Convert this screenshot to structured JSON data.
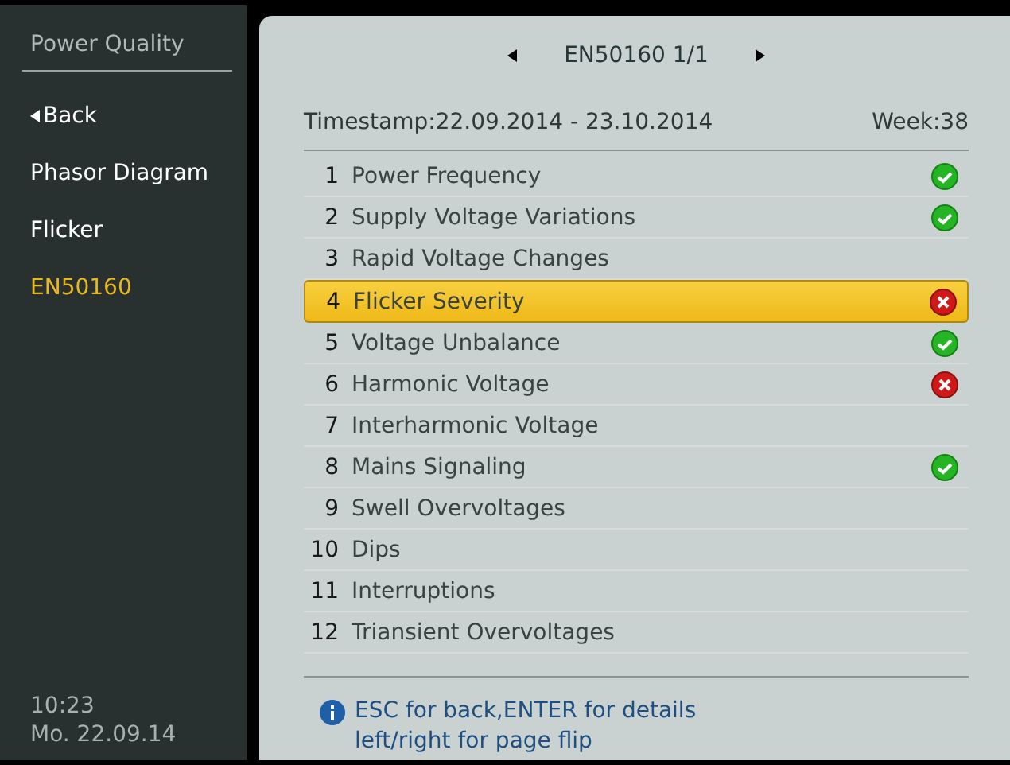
{
  "sidebar": {
    "title": "Power Quality",
    "items": [
      {
        "label": "Back",
        "kind": "back",
        "selected": false
      },
      {
        "label": "Phasor Diagram",
        "kind": "page",
        "selected": false
      },
      {
        "label": "Flicker",
        "kind": "page",
        "selected": false
      },
      {
        "label": "EN50160",
        "kind": "page",
        "selected": true
      }
    ],
    "time": "10:23",
    "date": "Mo. 22.09.14"
  },
  "header": {
    "title": "EN50160 1/1",
    "timestamp": "Timestamp:22.09.2014 - 23.10.2014",
    "week": "Week:38"
  },
  "rows": [
    {
      "number": "1",
      "label": "Power Frequency",
      "kind": "pass",
      "selected": false
    },
    {
      "number": "2",
      "label": "Supply Voltage Variations",
      "kind": "pass",
      "selected": false
    },
    {
      "number": "3",
      "label": "Rapid Voltage Changes",
      "kind": "none",
      "selected": false
    },
    {
      "number": "4",
      "label": "Flicker Severity",
      "kind": "fail",
      "selected": true
    },
    {
      "number": "5",
      "label": "Voltage Unbalance",
      "kind": "pass",
      "selected": false
    },
    {
      "number": "6",
      "label": "Harmonic Voltage",
      "kind": "fail",
      "selected": false
    },
    {
      "number": "7",
      "label": "Interharmonic Voltage",
      "kind": "none",
      "selected": false
    },
    {
      "number": "8",
      "label": "Mains Signaling",
      "kind": "pass",
      "selected": false
    },
    {
      "number": "9",
      "label": "Swell Overvoltages",
      "kind": "none",
      "selected": false
    },
    {
      "number": "10",
      "label": "Dips",
      "kind": "none",
      "selected": false
    },
    {
      "number": "11",
      "label": "Interruptions",
      "kind": "none",
      "selected": false
    },
    {
      "number": "12",
      "label": "Triansient Overvoltages",
      "kind": "none",
      "selected": false
    }
  ],
  "hint": [
    "ESC for back,ENTER for details",
    "left/right for page flip"
  ]
}
